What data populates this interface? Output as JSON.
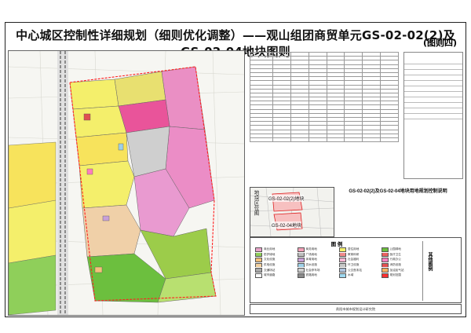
{
  "title": "中心城区控制性详细规划（细则优化调整）——观山组团商贸单元GS-02-02(2)及GS-02-04地块图则",
  "title_tail": "(图则四)",
  "inset": {
    "vertical_label": "地块区位图",
    "label_a": "GS-02-02(2)地块",
    "label_b": "GS-02-04地块"
  },
  "notes": {
    "title": "GS-02-02(2)及GS-02-04地块用地规划控制说明"
  },
  "legend": {
    "title": "图 例",
    "other_title": "其他图例",
    "items": [
      "商业用地",
      "商务用地",
      "居住用地",
      "公园绿地",
      "防护绿地",
      "广场用地",
      "教育科研",
      "医疗卫生",
      "文化设施",
      "体育用地",
      "社会福利",
      "行政办公",
      "供电设施",
      "供水设施",
      "环卫设施",
      "消防设施",
      "交通场站",
      "社会停车场",
      "公交首末站",
      "加油加气站",
      "城市道路",
      "铁路用地",
      "水域",
      "规划范围"
    ],
    "colors": [
      "#e9a3c9",
      "#f2a0b8",
      "#f4ef6b",
      "#6cbf3e",
      "#8fcf5a",
      "#bdbdbd",
      "#f08a8a",
      "#e86060",
      "#f5c07a",
      "#c8a0d8",
      "#f7b7d4",
      "#ff7fbf",
      "#f2d0a0",
      "#9ed0e8",
      "#c6c6c6",
      "#e05050",
      "#aaaaaa",
      "#d0d0d0",
      "#b0c4de",
      "#ffb060",
      "#ffffff",
      "#8a8a8a",
      "#9ed8f0",
      "#ff3030"
    ]
  },
  "footer": {
    "left": "",
    "mid": "贵阳市城市规划设计研究院",
    "right": ""
  }
}
